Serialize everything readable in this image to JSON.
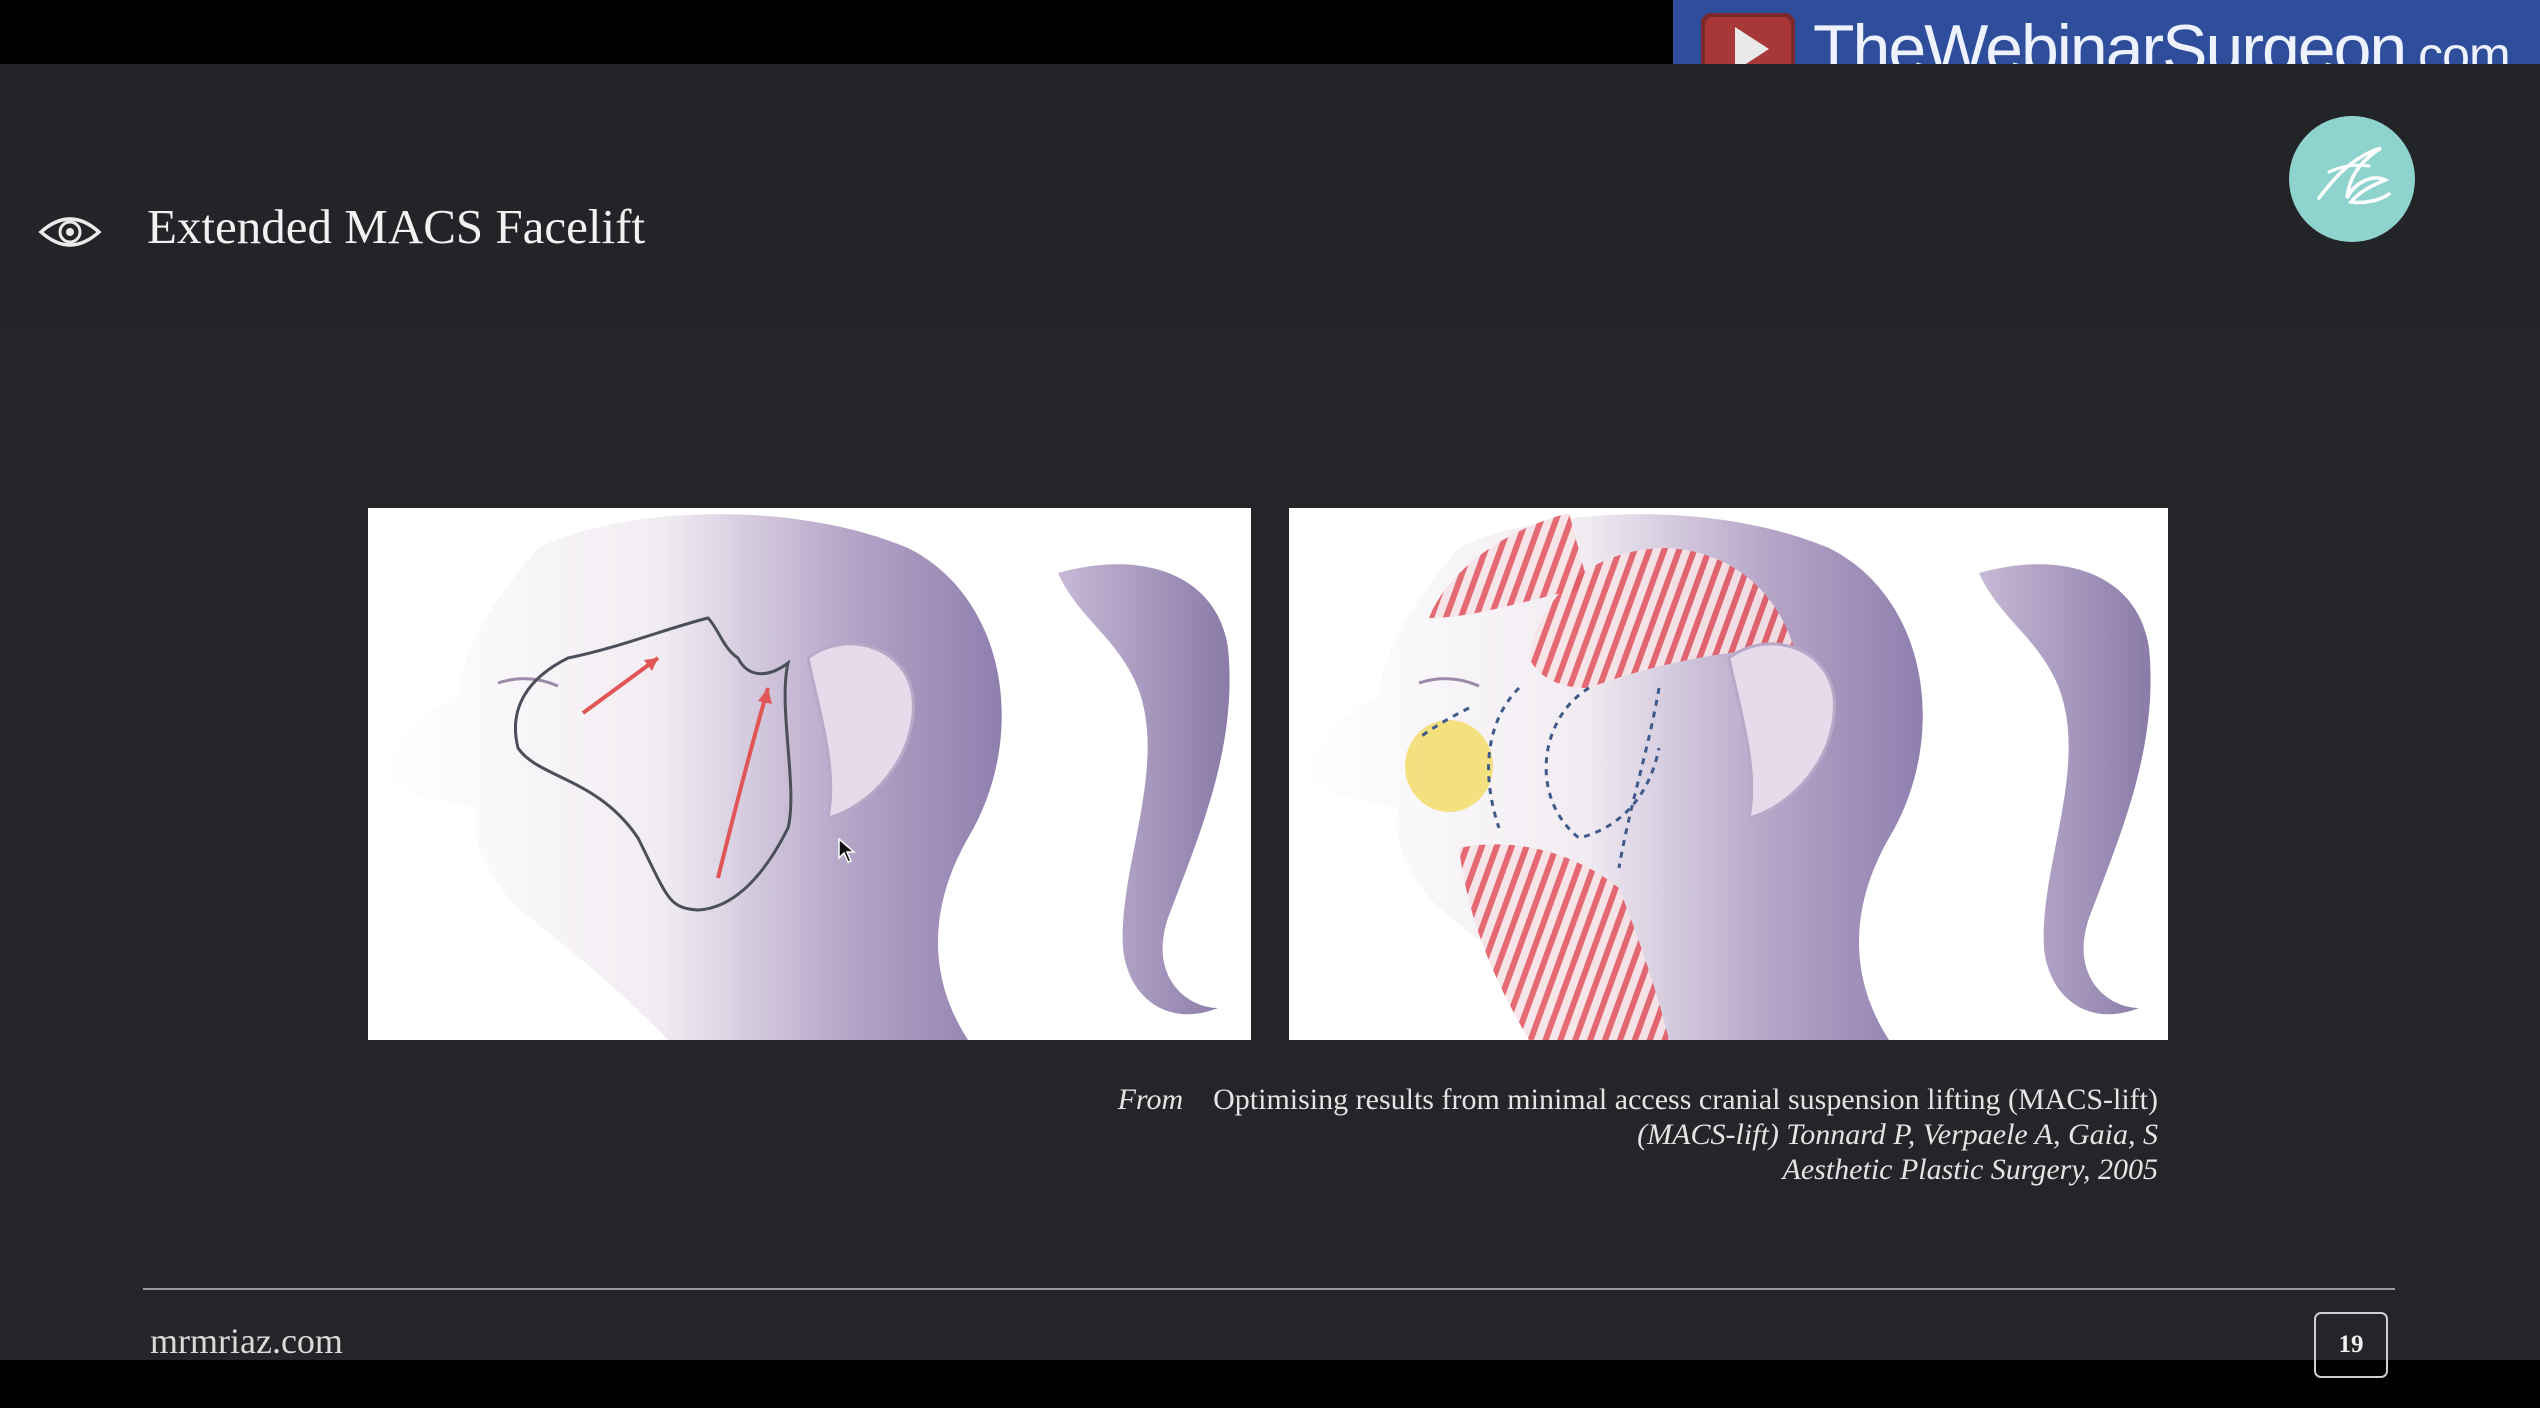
{
  "banner": {
    "site_main": "TheWebinarSurgeon",
    "site_tld": ".com",
    "icon": "play-icon",
    "color": "#2e4d9a"
  },
  "slide": {
    "title": "Extended MACS Facelift",
    "title_icon": "eye-icon",
    "logo_icon": "signature-logo-icon",
    "logo_color": "#8fd3cf",
    "background": "#242528"
  },
  "figures": [
    {
      "name": "face-illustration-incision-and-vectors"
    },
    {
      "name": "face-illustration-muscle-anatomy"
    }
  ],
  "citation": {
    "from_label": "From",
    "line1": "Optimising results from minimal access cranial suspension lifting (MACS-lift)",
    "line2": "(MACS-lift) Tonnard P, Verpaele A, Gaia, S",
    "line3": "Aesthetic Plastic Surgery, 2005"
  },
  "footer": {
    "site": "mrmriaz.com",
    "page_number": "19"
  }
}
